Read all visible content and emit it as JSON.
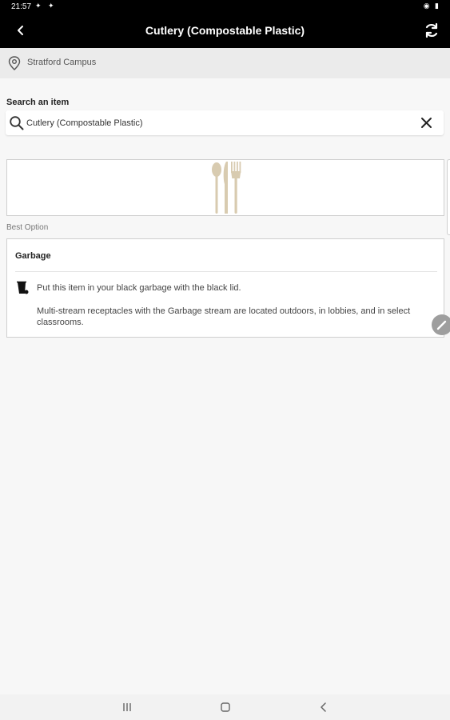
{
  "status_bar": {
    "time": "21:57"
  },
  "app_bar": {
    "title": "Cutlery (Compostable Plastic)",
    "back_icon": "chevron-left-icon",
    "refresh_icon": "refresh-icon"
  },
  "campus": {
    "label": "Stratford Campus",
    "icon": "location-pin-icon"
  },
  "search": {
    "label": "Search an item",
    "value": "Cutlery (Compostable Plastic)",
    "search_icon": "search-icon",
    "clear_icon": "close-icon"
  },
  "item_image": {
    "icon": "cutlery-icon",
    "color": "#d8cbb0"
  },
  "result": {
    "section_label": "Best Option",
    "option_title": "Garbage",
    "bin_icon": "garbage-bin-icon",
    "instruction": "Put this item in your black garbage with the black lid.",
    "note": "Multi-stream receptacles with the Garbage stream are located outdoors, in lobbies, and in select classrooms."
  },
  "nav_bar": {
    "recents_icon": "recents-icon",
    "home_icon": "home-icon",
    "back_icon": "back-icon"
  }
}
